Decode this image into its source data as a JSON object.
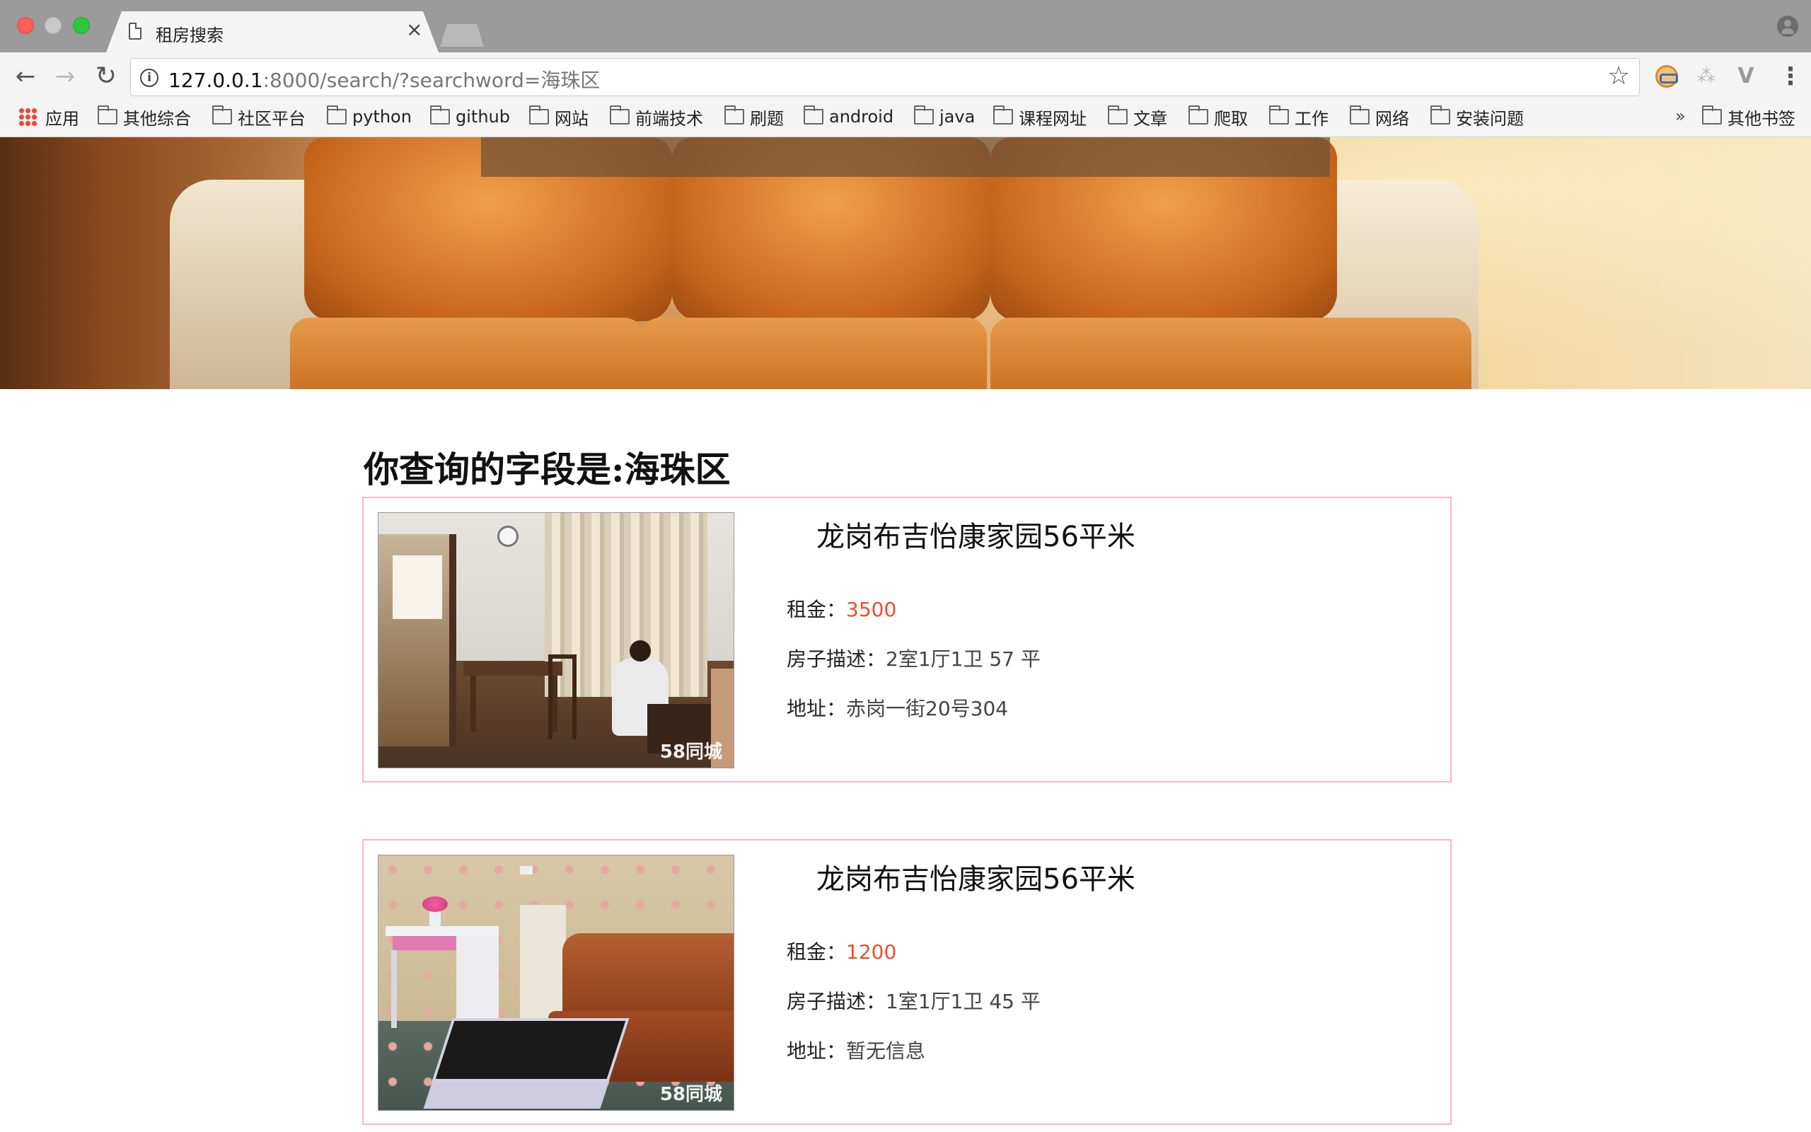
{
  "browser": {
    "tab_title": "租房搜索",
    "tab_close": "×",
    "url_host": "127.0.0.1",
    "url_rest": ":8000/search/?searchword=海珠区",
    "bookmarks": [
      {
        "label": "应用",
        "icon": "apps-icon"
      },
      {
        "label": "其他综合",
        "icon": "folder-icon"
      },
      {
        "label": "社区平台",
        "icon": "folder-icon"
      },
      {
        "label": "python",
        "icon": "folder-icon"
      },
      {
        "label": "github",
        "icon": "folder-icon"
      },
      {
        "label": "网站",
        "icon": "folder-icon"
      },
      {
        "label": "前端技术",
        "icon": "folder-icon"
      },
      {
        "label": "刷题",
        "icon": "folder-icon"
      },
      {
        "label": "android",
        "icon": "folder-icon"
      },
      {
        "label": "java",
        "icon": "folder-icon"
      },
      {
        "label": "课程网址",
        "icon": "folder-icon"
      },
      {
        "label": "文章",
        "icon": "folder-icon"
      },
      {
        "label": "爬取",
        "icon": "folder-icon"
      },
      {
        "label": "工作",
        "icon": "folder-icon"
      },
      {
        "label": "网络",
        "icon": "folder-icon"
      },
      {
        "label": "安装问题",
        "icon": "folder-icon"
      }
    ],
    "bookmarks_overflow": "»",
    "other_bookmarks": "其他书签"
  },
  "page": {
    "heading": "你查询的字段是:海珠区",
    "listings": [
      {
        "title": "龙岗布吉怡康家园56平米",
        "rent_label": "租金：",
        "rent": "3500",
        "desc_label": "房子描述：",
        "desc": "2室1厅1卫 57 平",
        "addr_label": "地址：",
        "addr": "赤岗一街20号304",
        "watermark": "58同城"
      },
      {
        "title": "龙岗布吉怡康家园56平米",
        "rent_label": "租金：",
        "rent": "1200",
        "desc_label": "房子描述：",
        "desc": "1室1厅1卫 45 平",
        "addr_label": "地址：",
        "addr": "暂无信息",
        "watermark": "58同城"
      }
    ]
  },
  "colors": {
    "price": "#f34b2b",
    "card_border": "#f7b6c8"
  }
}
